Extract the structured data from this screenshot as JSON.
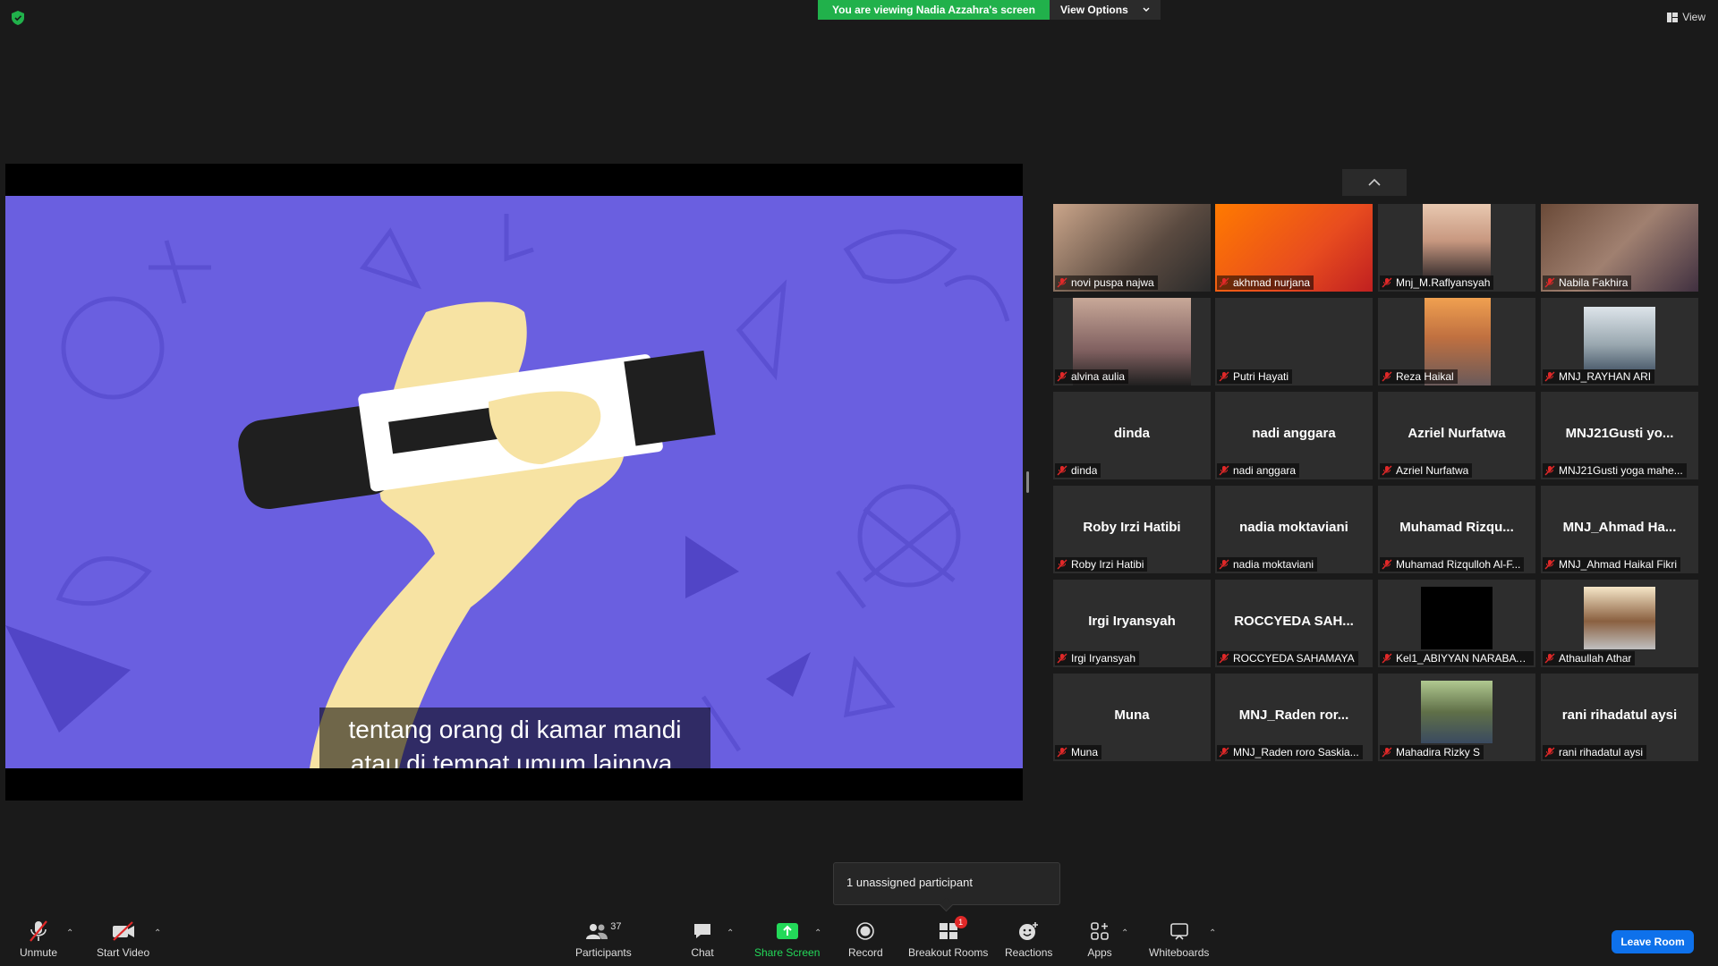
{
  "banner": {
    "sharing_text": "You are viewing Nadia Azzahra's screen",
    "view_options_label": "View Options"
  },
  "view_label": "View",
  "shared_screen": {
    "caption_line1": "tentang orang di kamar mandi",
    "caption_line2": "atau di tempat umum lainnya,"
  },
  "gallery": [
    {
      "name": "novi puspa najwa",
      "big": ""
    },
    {
      "name": "akhmad nurjana",
      "big": ""
    },
    {
      "name": "Mnj_M.Raflyansyah",
      "big": ""
    },
    {
      "name": "Nabila Fakhira",
      "big": ""
    },
    {
      "name": "alvina aulia",
      "big": ""
    },
    {
      "name": "Putri Hayati",
      "big": ""
    },
    {
      "name": "Reza Haikal",
      "big": ""
    },
    {
      "name": "MNJ_RAYHAN ARI",
      "big": ""
    },
    {
      "name": "dinda",
      "big": "dinda"
    },
    {
      "name": "nadi anggara",
      "big": "nadi anggara"
    },
    {
      "name": "Azriel Nurfatwa",
      "big": "Azriel Nurfatwa"
    },
    {
      "name": "MNJ21Gusti yoga mahe...",
      "big": "MNJ21Gusti yo..."
    },
    {
      "name": "Roby Irzi Hatibi",
      "big": "Roby Irzi Hatibi"
    },
    {
      "name": "nadia moktaviani",
      "big": "nadia moktaviani"
    },
    {
      "name": "Muhamad Rizqulloh Al-F...",
      "big": "Muhamad Rizqu..."
    },
    {
      "name": "MNJ_Ahmad Haikal Fikri",
      "big": "MNJ_Ahmad Ha..."
    },
    {
      "name": "Irgi Iryansyah",
      "big": "Irgi Iryansyah"
    },
    {
      "name": "ROCCYEDA SAHAMAYA",
      "big": "ROCCYEDA SAH..."
    },
    {
      "name": "Kel1_ABIYYAN NARABAY...",
      "big": ""
    },
    {
      "name": "Athaullah Athar",
      "big": ""
    },
    {
      "name": "Muna",
      "big": "Muna"
    },
    {
      "name": "MNJ_Raden roro Saskia...",
      "big": "MNJ_Raden ror..."
    },
    {
      "name": "Mahadira Rizky S",
      "big": ""
    },
    {
      "name": "rani rihadatul aysi",
      "big": "rani rihadatul aysi"
    }
  ],
  "tooltip": "1 unassigned participant",
  "toolbar": {
    "unmute": "Unmute",
    "start_video": "Start Video",
    "participants": "Participants",
    "participants_count": "37",
    "chat": "Chat",
    "share_screen": "Share Screen",
    "record": "Record",
    "breakout_rooms": "Breakout Rooms",
    "breakout_badge": "1",
    "reactions": "Reactions",
    "apps": "Apps",
    "whiteboards": "Whiteboards",
    "leave_room": "Leave Room"
  },
  "colors": {
    "banner_green": "#21b14b",
    "leave_blue": "#0e71eb",
    "share_green": "#23d959",
    "mute_red": "#e02828",
    "share_bg": "#6a5fe0"
  }
}
